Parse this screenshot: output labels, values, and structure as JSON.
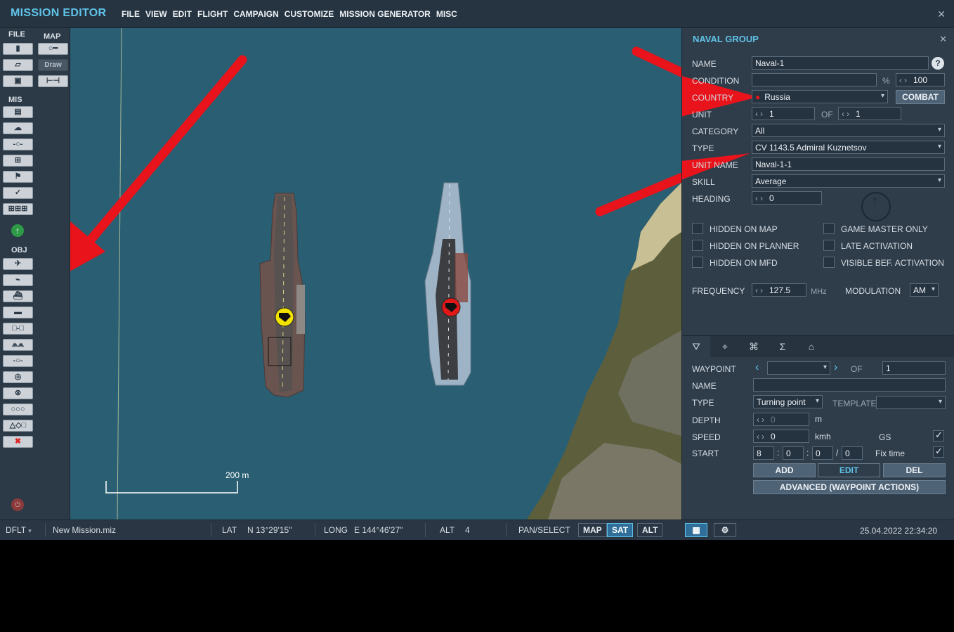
{
  "app": {
    "title": "MISSION EDITOR",
    "menu": [
      "FILE",
      "VIEW",
      "EDIT",
      "FLIGHT",
      "CAMPAIGN",
      "CUSTOMIZE",
      "MISSION GENERATOR",
      "MISC"
    ]
  },
  "toolbar": {
    "file_label": "FILE",
    "map_label": "MAP",
    "mis_label": "MIS",
    "obj_label": "OBJ",
    "draw_label": "Draw"
  },
  "map": {
    "scale_label": "200 m"
  },
  "panel": {
    "title": "NAVAL GROUP",
    "name_label": "NAME",
    "name_value": "Naval-1",
    "help": "?",
    "condition_label": "CONDITION",
    "condition_value": "",
    "percent": "%",
    "probability_value": "100",
    "country_label": "COUNTRY",
    "country_value": "Russia",
    "combat_button": "COMBAT",
    "unit_label": "UNIT",
    "unit_value": "1",
    "of_label": "OF",
    "unit_of_value": "1",
    "category_label": "CATEGORY",
    "category_value": "All",
    "type_label": "TYPE",
    "type_value": "CV 1143.5 Admiral Kuznetsov",
    "unit_name_label": "UNIT NAME",
    "unit_name_value": "Naval-1-1",
    "skill_label": "SKILL",
    "skill_value": "Average",
    "heading_label": "HEADING",
    "heading_value": "0",
    "checks": [
      {
        "label": "HIDDEN ON MAP",
        "checked": false
      },
      {
        "label": "GAME MASTER ONLY",
        "checked": false
      },
      {
        "label": "HIDDEN ON PLANNER",
        "checked": false
      },
      {
        "label": "LATE ACTIVATION",
        "checked": false
      },
      {
        "label": "HIDDEN ON MFD",
        "checked": false
      },
      {
        "label": "VISIBLE BEF. ACTIVATION",
        "checked": false
      }
    ],
    "frequency_label": "FREQUENCY",
    "frequency_value": "127.5",
    "mhz": "MHz",
    "modulation_label": "MODULATION",
    "modulation_value": "AM",
    "waypoint": {
      "waypoint_label": "WAYPOINT",
      "waypoint_value": "",
      "of_label": "OF",
      "of_value": "1",
      "name_label": "NAME",
      "name_value": "",
      "type_label": "TYPE",
      "type_value": "Turning point",
      "template_label": "TEMPLATE",
      "template_value": "",
      "depth_label": "DEPTH",
      "depth_value": "0",
      "depth_unit": "m",
      "speed_label": "SPEED",
      "speed_value": "0",
      "speed_unit": "kmh",
      "gs_label": "GS",
      "gs_checked": true,
      "start_label": "START",
      "start_d": "8",
      "start_h": "0",
      "start_m": "0",
      "start_s": "0",
      "colon": ":",
      "slash": "/",
      "fixtime_label": "Fix time",
      "fixtime_checked": true,
      "add_button": "ADD",
      "edit_button": "EDIT",
      "del_button": "DEL",
      "advanced_button": "ADVANCED (WAYPOINT ACTIONS)"
    }
  },
  "status": {
    "profile": "DFLT",
    "file": "New Mission.miz",
    "lat_label": "LAT",
    "lat_value": "N 13°29'15\"",
    "long_label": "LONG",
    "long_value": "E 144°46'27\"",
    "alt_label": "ALT",
    "alt_value": "4",
    "mode": "PAN/SELECT",
    "map_btn": "MAP",
    "sat_btn": "SAT",
    "alt_btn": "ALT",
    "datetime": "25.04.2022 22:34:20"
  },
  "colors": {
    "accent": "#5fc3e8",
    "sea": "#2a5e72",
    "red_marker": "#e01818",
    "yellow_marker": "#f2e200"
  }
}
